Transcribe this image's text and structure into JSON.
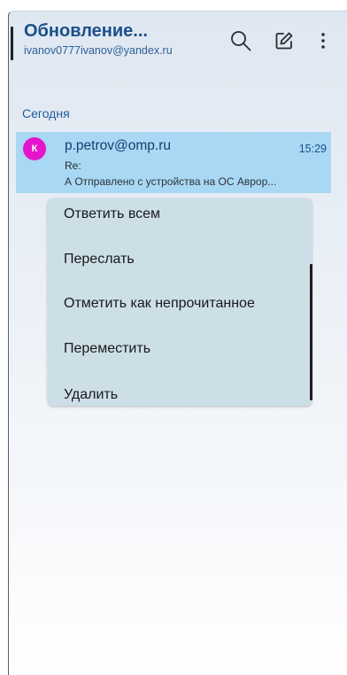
{
  "header": {
    "title": "Обновление...",
    "account": "ivanov0777ivanov@yandex.ru",
    "icons": {
      "search": "search-icon",
      "compose": "compose-icon",
      "more": "more-vertical-icon"
    }
  },
  "section": {
    "label": "Сегодня"
  },
  "message": {
    "avatar_letter": "К",
    "sender": "p.petrov@omp.ru",
    "time": "15:29",
    "subject": "Re:",
    "preview": "А Отправлено с устройства на ОС Авроp...",
    "selected": true
  },
  "context_menu": {
    "items": [
      "Ответить всем",
      "Переслать",
      "Отметить как непрочитанное",
      "Переместить",
      "Удалить"
    ]
  },
  "colors": {
    "accent": "#1b4f8a",
    "selected_row": "#a9d8f4",
    "avatar": "#e515cc",
    "menu_bg": "#cddfe6"
  }
}
